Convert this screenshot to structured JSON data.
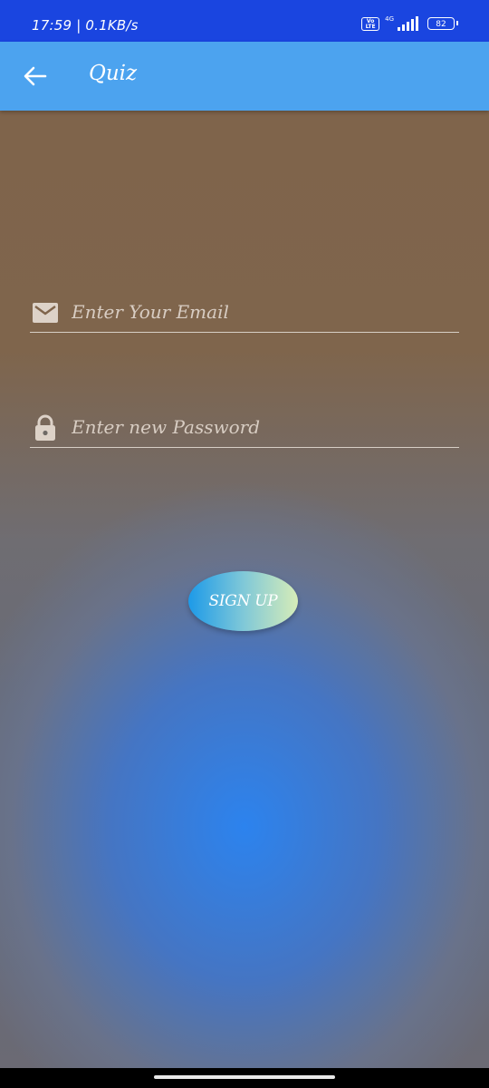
{
  "status_bar": {
    "time_speed": "17:59 | 0.1KB/s",
    "volte_text": "Vo LTE",
    "network_type": "4G",
    "battery_level": "82",
    "signal_strength": 5
  },
  "app_bar": {
    "title": "Quiz",
    "back_icon": "arrow-left-icon"
  },
  "form": {
    "email": {
      "icon": "envelope-icon",
      "placeholder": "Enter Your Email",
      "value": ""
    },
    "password": {
      "icon": "lock-icon",
      "placeholder": "Enter new Password",
      "value": ""
    },
    "signup_label": "SIGN UP"
  },
  "colors": {
    "status_bar_bg": "#1a45e0",
    "app_bar_bg": "#4ca3ef",
    "background_top": "#7f644b",
    "background_glow": "#2c83ee",
    "button_gradient_start": "#1d9ae8",
    "button_gradient_end": "#d6ecb8"
  }
}
